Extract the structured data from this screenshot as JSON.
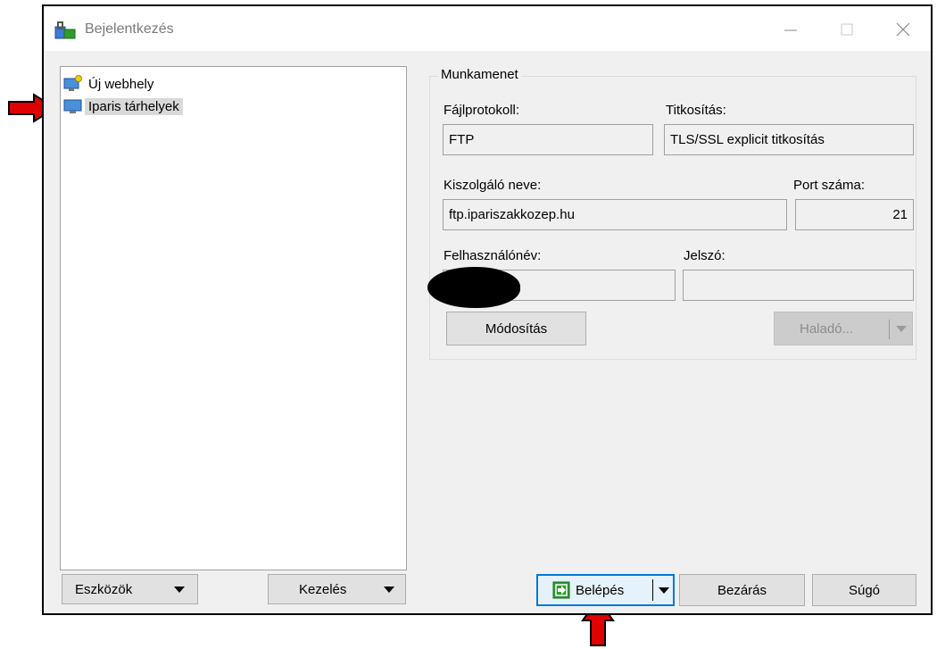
{
  "window": {
    "title": "Bejelentkezés"
  },
  "tree": {
    "items": [
      {
        "label": "Új webhely"
      },
      {
        "label": "Iparis tárhelyek"
      }
    ]
  },
  "left_buttons": {
    "eszkozok": "Eszközök",
    "kezeles": "Kezelés"
  },
  "session": {
    "group_title": "Munkamenet",
    "protocol_label": "Fájlprotokoll:",
    "protocol_value": "FTP",
    "encryption_label": "Titkosítás:",
    "encryption_value": "TLS/SSL explicit titkosítás",
    "host_label": "Kiszolgáló neve:",
    "host_value": "ftp.ipariszakkozep.hu",
    "port_label": "Port száma:",
    "port_value": "21",
    "user_label": "Felhasználónév:",
    "user_value": "",
    "password_label": "Jelszó:",
    "password_value": "",
    "modify_button": "Módosítás",
    "advanced_button": "Haladó..."
  },
  "bottom_buttons": {
    "login": "Belépés",
    "close": "Bezárás",
    "help": "Súgó"
  },
  "colors": {
    "annotation_arrow": "#e00000",
    "focus_border": "#0078d7",
    "login_icon": "#2e9c2e"
  },
  "icons": {
    "app": "winscp-icon",
    "new_site": "monitor-new-icon",
    "site": "monitor-icon",
    "login": "login-icon"
  }
}
